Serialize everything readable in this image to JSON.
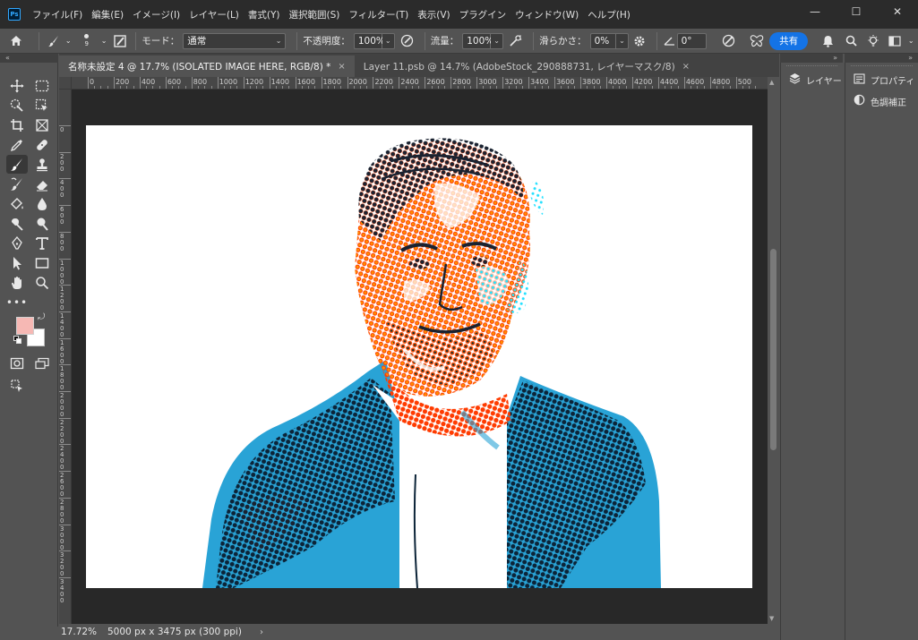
{
  "app": {
    "logo_text": "Ps",
    "menus": [
      "ファイル(F)",
      "編集(E)",
      "イメージ(I)",
      "レイヤー(L)",
      "書式(Y)",
      "選択範囲(S)",
      "フィルター(T)",
      "表示(V)",
      "プラグイン",
      "ウィンドウ(W)",
      "ヘルプ(H)"
    ],
    "window_controls": {
      "minimize": "—",
      "maximize": "☐",
      "close": "✕"
    }
  },
  "options_bar": {
    "brush_size": "9",
    "mode_label": "モード：",
    "mode_value": "通常",
    "opacity_label": "不透明度：",
    "opacity_value": "100%",
    "flow_label": "流量：",
    "flow_value": "100%",
    "smoothing_label": "滑らかさ：",
    "smoothing_value": "0%",
    "angle_value": "0°",
    "share_label": "共有"
  },
  "tabs": [
    {
      "label": "名称未設定 4 @ 17.7% (ISOLATED IMAGE HERE, RGB/8) *",
      "close": "×",
      "active": true
    },
    {
      "label": "Layer 11.psb @ 14.7% (AdobeStock_290888731, レイヤーマスク/8)",
      "close": "×",
      "active": false
    }
  ],
  "rulers": {
    "top_labels": [
      "0",
      "200",
      "400",
      "600",
      "800",
      "1000",
      "1200",
      "1400",
      "1600",
      "1800",
      "2000",
      "2200",
      "2400",
      "2600",
      "2800",
      "3000",
      "3200",
      "3400",
      "3600",
      "3800",
      "4000",
      "4200",
      "4400",
      "4600",
      "4800",
      "500"
    ],
    "left_labels": [
      "0",
      "2 0 0",
      "4 0 0",
      "6 0 0",
      "8 0 0",
      "1 0 0 0",
      "1 2 0 0",
      "1 4 0 0",
      "1 6 0 0",
      "1 8 0 0",
      "2 0 0 0",
      "2 2 0 0",
      "2 4 0 0",
      "2 6 0 0",
      "2 8 0 0",
      "3 0 0 0",
      "3 2 0 0",
      "3 4 0 0"
    ]
  },
  "status_bar": {
    "zoom": "17.72%",
    "doc_info": "5000 px x 3475 px (300 ppi)",
    "arrow": "›"
  },
  "panels": {
    "layers_label": "レイヤー",
    "properties_label": "プロパティ",
    "adjustments_label": "色調補正"
  },
  "colors": {
    "foreground": "#f6b8b4",
    "background": "#ffffff",
    "accent": "#1473e6",
    "halftone_orange": "#ff4500",
    "halftone_blue": "#29a3d6"
  }
}
